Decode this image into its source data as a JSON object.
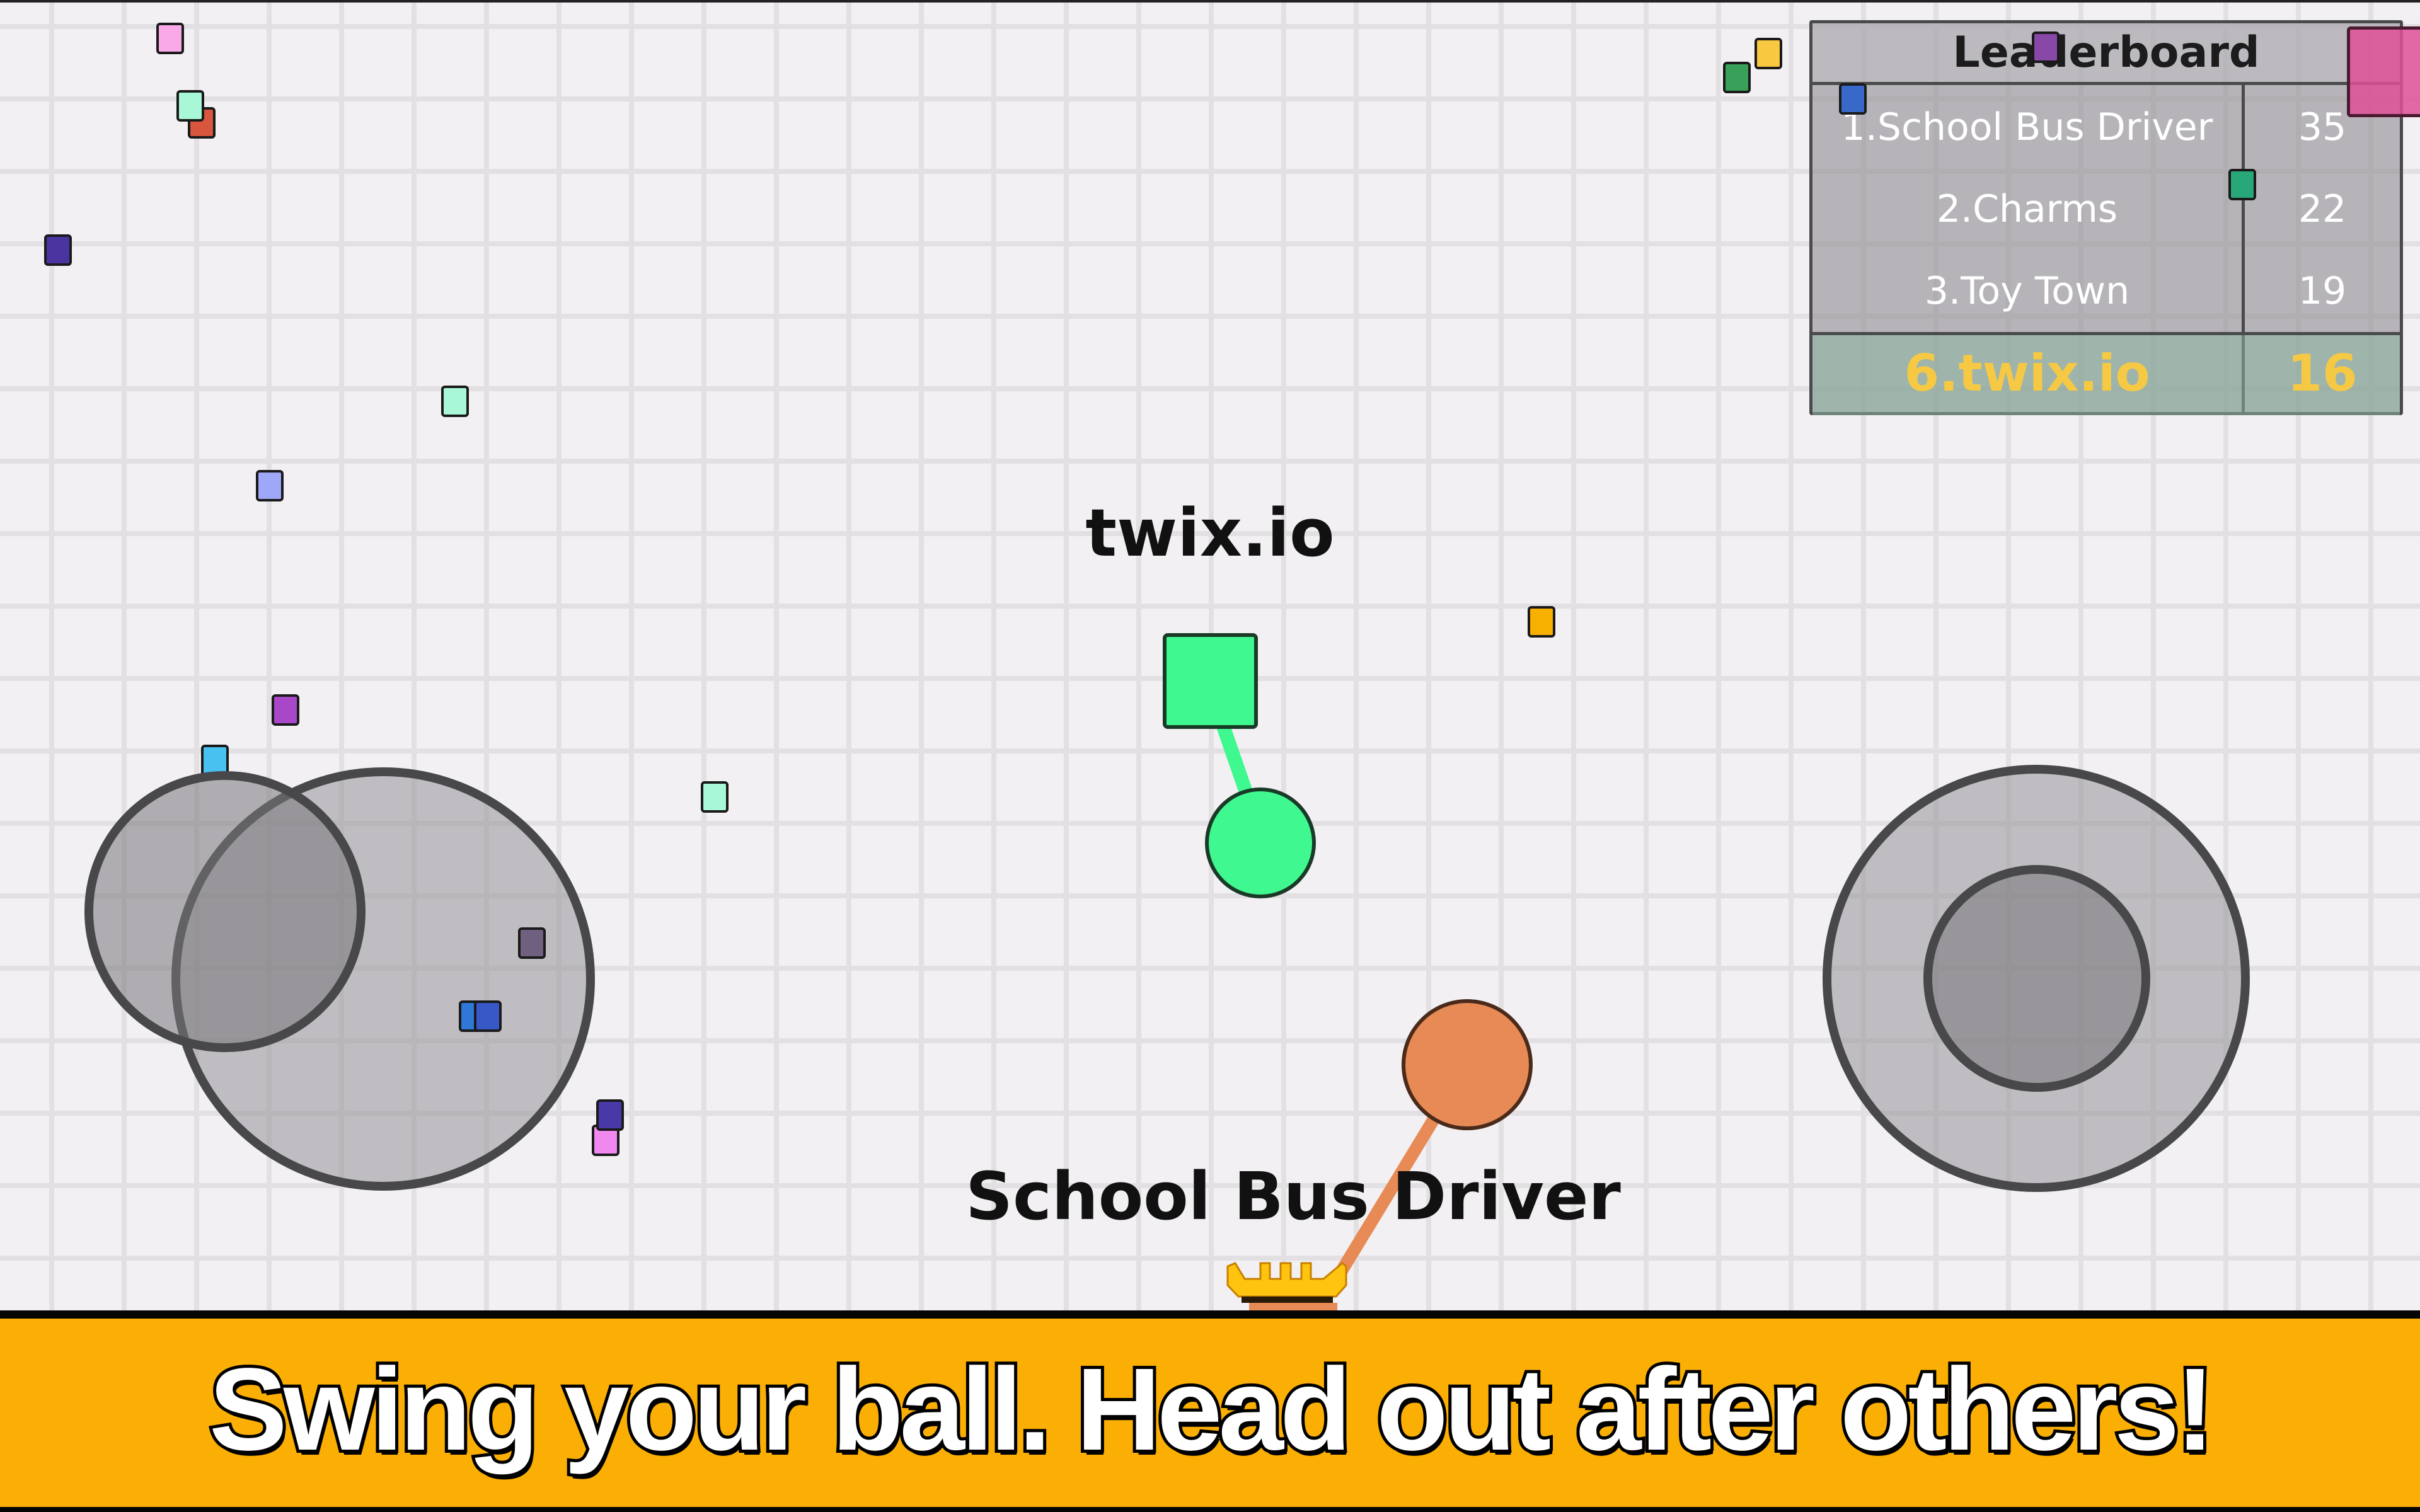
{
  "game": {
    "title": "twix.io"
  },
  "leaderboard": {
    "title": "Leaderboard",
    "entries": [
      {
        "rank_name": "1.School Bus Driver",
        "score": "35"
      },
      {
        "rank_name": "2.Charms",
        "score": "22"
      },
      {
        "rank_name": "3.Toy Town",
        "score": "19"
      }
    ],
    "self": {
      "rank_name": "6.twix.io",
      "score": "16"
    },
    "self_color": "#F6C945"
  },
  "players": [
    {
      "name": "twix.io",
      "color": "#40F890",
      "shape": "square-with-ball",
      "is_self": true
    },
    {
      "name": "School Bus Driver",
      "color": "#E78A55",
      "shape": "crown-with-ball",
      "is_leader": true
    }
  ],
  "controls": {
    "left_joystick": "move-joystick",
    "right_joystick": "swing-joystick"
  },
  "food_colors": [
    "#F9A8E8",
    "#A8F8D8",
    "#D8553E",
    "#4A35A0",
    "#9FA8F8",
    "#A848C8",
    "#48C0F0",
    "#706080",
    "#3858C8",
    "#3078D8",
    "#4838A8",
    "#F088F0",
    "#F8C840",
    "#38A058",
    "#3868C8",
    "#8848A8",
    "#28A878",
    "#F8B000",
    "#D05090"
  ],
  "banner": {
    "text": "Swing your ball. Head out after others!",
    "color": "#FBAE04"
  }
}
